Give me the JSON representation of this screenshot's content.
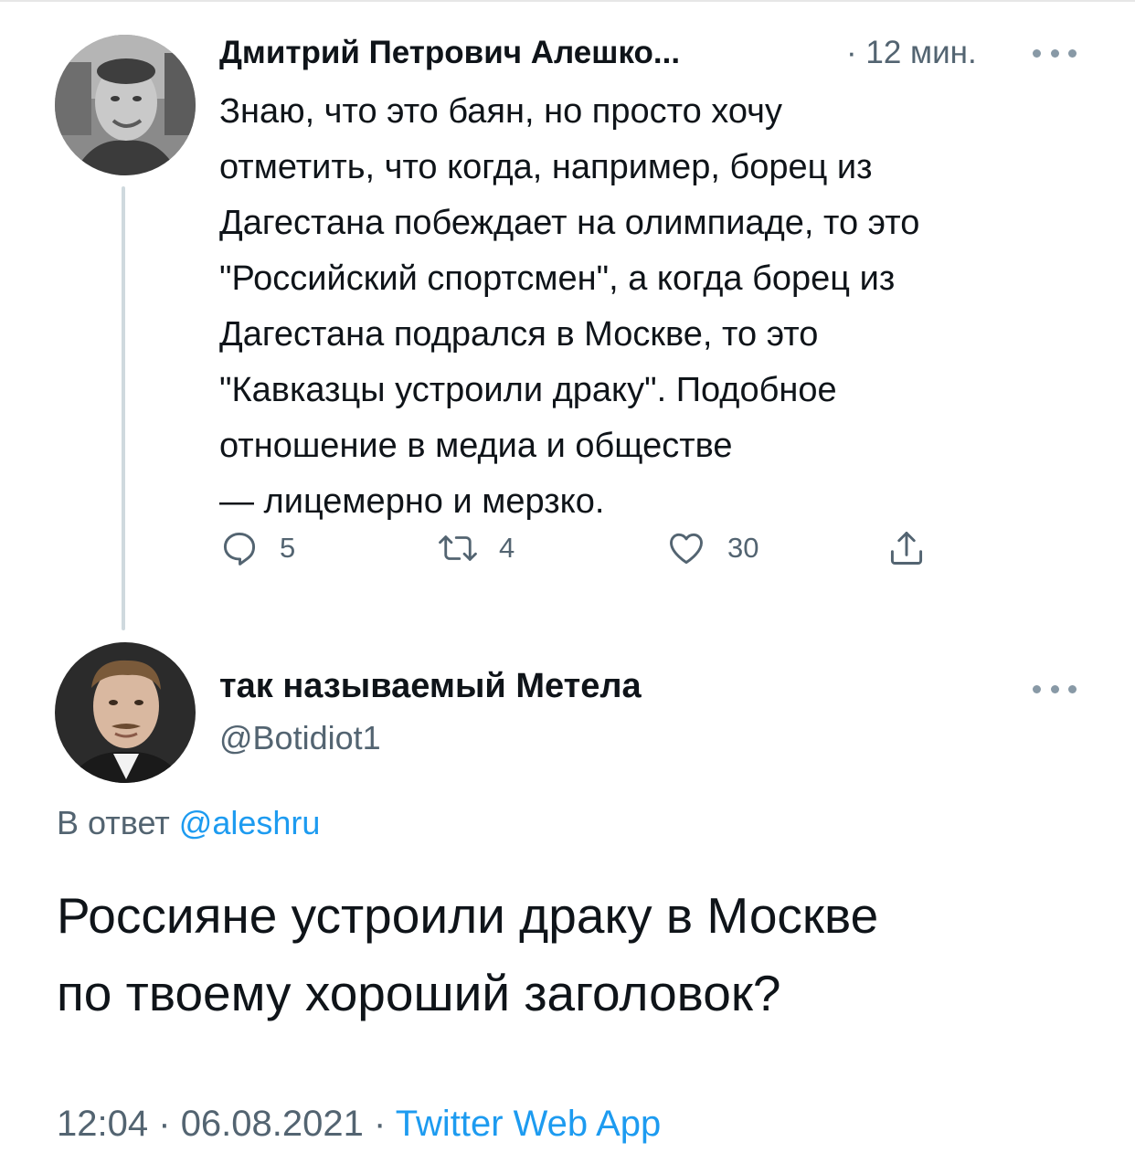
{
  "colors": {
    "text_primary": "#0f1419",
    "text_secondary": "#536471",
    "accent": "#1d9bf0",
    "thread_line": "#cfd9de"
  },
  "parent_tweet": {
    "author_name": "Дмитрий Петрович Алешко...",
    "time": "· 12 мин.",
    "more_icon": "more-horizontal-icon",
    "text_lines": [
      "Знаю, что это баян, но просто хочу",
      "отметить, что когда, например, борец из",
      "Дагестана побеждает на олимпиаде, то это",
      "\"Российский спортсмен\", а когда борец из",
      "Дагестана подрался в Москве, то это",
      "\"Кавказцы устроили драку\". Подобное",
      "отношение в медиа и обществе",
      "— лицемерно и мерзко."
    ],
    "actions": {
      "reply": {
        "icon": "reply-icon",
        "count": "5"
      },
      "retweet": {
        "icon": "retweet-icon",
        "count": "4"
      },
      "like": {
        "icon": "heart-icon",
        "count": "30"
      },
      "share": {
        "icon": "share-icon"
      }
    }
  },
  "reply_tweet": {
    "author_name": "так называемый Метела",
    "handle": "@Botidiot1",
    "more_icon": "more-horizontal-icon",
    "replying_prefix": "В ответ",
    "replying_mention": "@aleshru",
    "text_lines": [
      "Россияне устроили драку в Москве",
      "по твоему хороший заголовок?"
    ],
    "time": "12:04",
    "date": "06.08.2021",
    "separator": "·",
    "source": "Twitter Web App"
  }
}
